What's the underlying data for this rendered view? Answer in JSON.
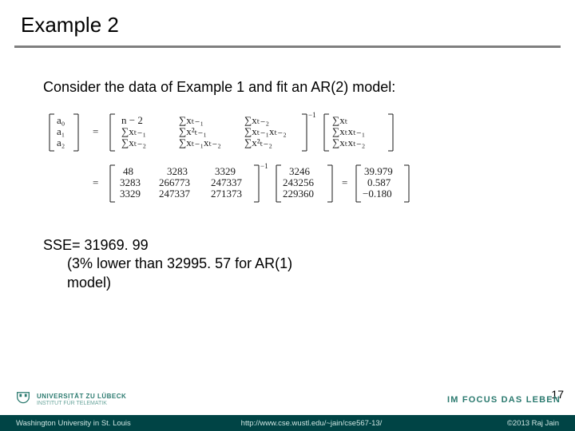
{
  "title": "Example 2",
  "intro": "Consider the data of Example 1 and fit an AR(2) model:",
  "equation": {
    "lhs_vec": [
      "a₀",
      "a₁",
      "a₂"
    ],
    "sym_matrix_row1": [
      "n − 2",
      "∑xₜ₋₁",
      "∑xₜ₋₂"
    ],
    "sym_matrix_row2": [
      "∑xₜ₋₁",
      "∑x²ₜ₋₁",
      "∑xₜ₋₁xₜ₋₂"
    ],
    "sym_matrix_row3": [
      "∑xₜ₋₂",
      "∑xₜ₋₁xₜ₋₂",
      "∑x²ₜ₋₂"
    ],
    "sym_rhs_vec": [
      "∑xₜ",
      "∑xₜxₜ₋₁",
      "∑xₜxₜ₋₂"
    ],
    "num_matrix_row1": [
      "48",
      "3283",
      "3329"
    ],
    "num_matrix_row2": [
      "3283",
      "266773",
      "247337"
    ],
    "num_matrix_row3": [
      "3329",
      "247337",
      "271373"
    ],
    "num_rhs_vec": [
      "3246",
      "243256",
      "229360"
    ],
    "result_vec": [
      "39.979",
      "0.587",
      "−0.180"
    ],
    "inverse_sup": "−1"
  },
  "sse_line": "SSE= 31969. 99",
  "sse_sub1": "(3% lower than 32995. 57 for AR(1)",
  "sse_sub2": "model)",
  "page_number": "17",
  "lubeck": {
    "line1": "UNIVERSITÄT ZU LÜBECK",
    "line2": "INSTITUT FÜR TELEMATIK"
  },
  "focus": "IM FOCUS DAS LEBEN",
  "footer": {
    "left": "Washington University in St. Louis",
    "center": "http://www.cse.wustl.edu/~jain/cse567-13/",
    "right": "©2013 Raj Jain"
  }
}
